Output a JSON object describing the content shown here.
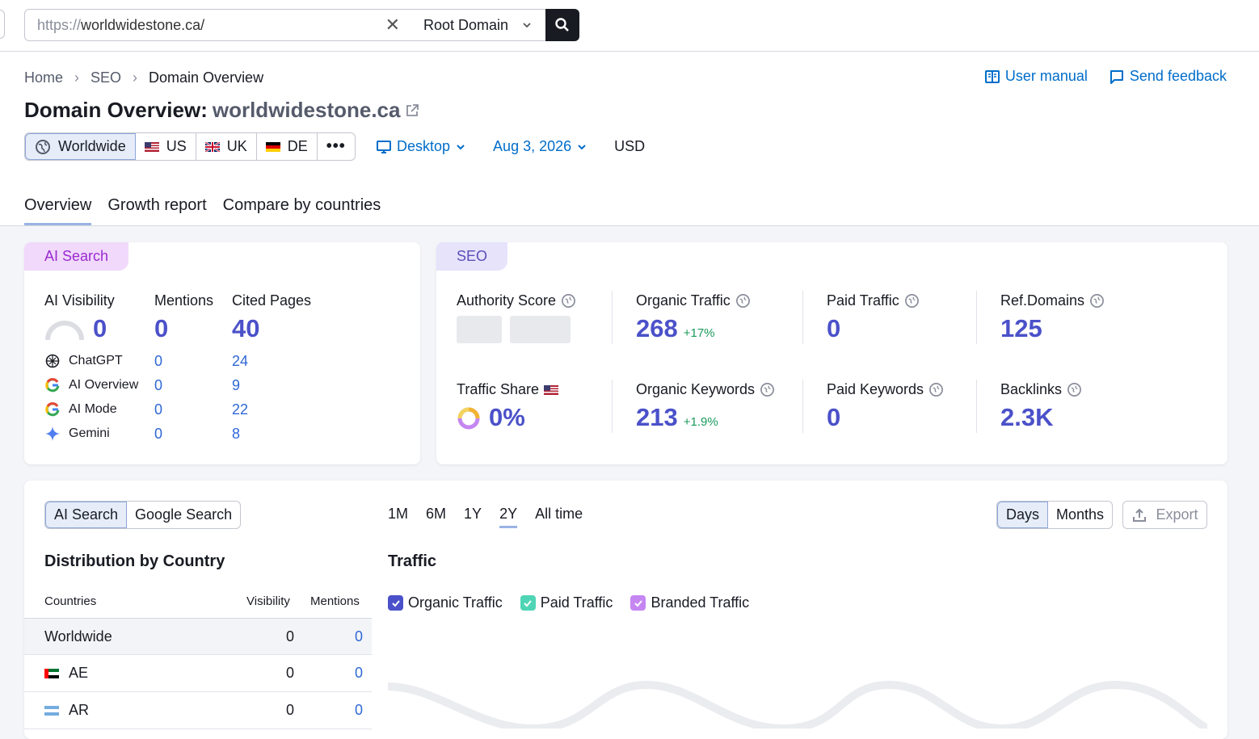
{
  "search": {
    "url_proto": "https://",
    "url_host": "worldwidestone.ca/",
    "scope": "Root Domain"
  },
  "breadcrumb": [
    "Home",
    "SEO",
    "Domain Overview"
  ],
  "top_links": {
    "manual": "User manual",
    "feedback": "Send feedback"
  },
  "title": {
    "prefix": "Domain Overview:",
    "domain": "worldwidestone.ca"
  },
  "databases": [
    "Worldwide",
    "US",
    "UK",
    "DE"
  ],
  "filters": {
    "device": "Desktop",
    "date": "Aug 3, 2026",
    "currency": "USD"
  },
  "main_tabs": [
    "Overview",
    "Growth report",
    "Compare by countries"
  ],
  "ai_card": {
    "tag": "AI Search",
    "headers": {
      "visibility": "AI Visibility",
      "mentions": "Mentions",
      "cited": "Cited Pages"
    },
    "totals": {
      "visibility": "0",
      "mentions": "0",
      "cited": "40"
    },
    "rows": [
      {
        "name": "ChatGPT",
        "mentions": "0",
        "cited": "24"
      },
      {
        "name": "AI Overview",
        "mentions": "0",
        "cited": "9"
      },
      {
        "name": "AI Mode",
        "mentions": "0",
        "cited": "22"
      },
      {
        "name": "Gemini",
        "mentions": "0",
        "cited": "8"
      }
    ]
  },
  "seo_card": {
    "tag": "SEO",
    "authority_label": "Authority Score",
    "organic_traffic": {
      "label": "Organic Traffic",
      "value": "268",
      "delta": "+17%"
    },
    "paid_traffic": {
      "label": "Paid Traffic",
      "value": "0"
    },
    "ref_domains": {
      "label": "Ref.Domains",
      "value": "125"
    },
    "traffic_share": {
      "label": "Traffic Share",
      "value": "0%"
    },
    "organic_keywords": {
      "label": "Organic Keywords",
      "value": "213",
      "delta": "+1.9%"
    },
    "paid_keywords": {
      "label": "Paid Keywords",
      "value": "0"
    },
    "backlinks": {
      "label": "Backlinks",
      "value": "2.3K"
    }
  },
  "bottom": {
    "source_tabs": [
      "AI Search",
      "Google Search"
    ],
    "periods": [
      "1M",
      "6M",
      "1Y",
      "2Y",
      "All time"
    ],
    "granularity": [
      "Days",
      "Months"
    ],
    "export": "Export",
    "dist_title": "Distribution by Country",
    "traffic_title": "Traffic",
    "table_headers": {
      "countries": "Countries",
      "visibility": "Visibility",
      "mentions": "Mentions"
    },
    "table_rows": [
      {
        "country": "Worldwide",
        "visibility": "0",
        "mentions": "0"
      },
      {
        "country": "AE",
        "visibility": "0",
        "mentions": "0"
      },
      {
        "country": "AR",
        "visibility": "0",
        "mentions": "0"
      }
    ],
    "legend": [
      "Organic Traffic",
      "Paid Traffic",
      "Branded Traffic"
    ]
  },
  "colors": {
    "accent": "#4b51c9",
    "link": "#006dca",
    "positive": "#1a9a5c",
    "organic": "#4b51c9",
    "paid": "#4fd5b5",
    "branded": "#c586f2"
  }
}
